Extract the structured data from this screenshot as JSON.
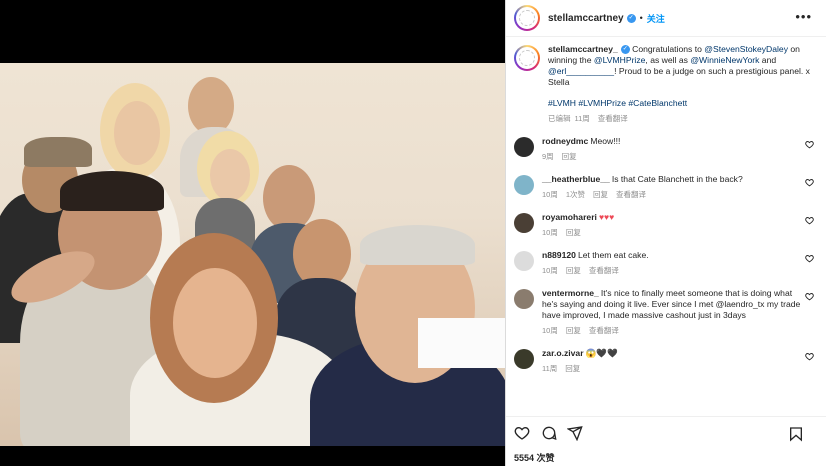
{
  "post": {
    "username": "stellamccartney",
    "follow_label": "关注",
    "separator": "•",
    "more_label": "•••",
    "caption": {
      "username": "stellamccartney_",
      "parts": [
        {
          "text": " Congratulations to ",
          "kind": "text"
        },
        {
          "text": "@StevenStokeyDaley",
          "kind": "mention"
        },
        {
          "text": " on winning the ",
          "kind": "text"
        },
        {
          "text": "@LVMHPrize",
          "kind": "mention"
        },
        {
          "text": ", as well as ",
          "kind": "text"
        },
        {
          "text": "@WinnieNewYork",
          "kind": "mention"
        },
        {
          "text": " and ",
          "kind": "text"
        },
        {
          "text": "@erl__________",
          "kind": "mention"
        },
        {
          "text": "! Proud to be a judge on such a prestigious panel. x Stella",
          "kind": "text"
        }
      ],
      "hashtags": "#LVMH #LVMHPrize #CateBlanchett",
      "edited": "已编辑",
      "time": "11周",
      "translate": "查看翻译"
    },
    "likes": "5554 次赞"
  },
  "comments": [
    {
      "user": "rodneydmc",
      "text": "Meow!!!",
      "time": "9周",
      "likes": "",
      "reply": "回复",
      "translate": "",
      "avatar_color": "#2b2b2b"
    },
    {
      "user": "__heatherblue__",
      "text": "Is that Cate Blanchett in the back?",
      "time": "10周",
      "likes": "1次赞",
      "reply": "回复",
      "translate": "查看翻译",
      "avatar_color": "#7fb4c9"
    },
    {
      "user": "royamohareri",
      "text": "♥♥♥",
      "time": "10周",
      "likes": "",
      "reply": "回复",
      "translate": "",
      "avatar_color": "#4a3f35"
    },
    {
      "user": "n889120",
      "text": "Let them eat cake.",
      "time": "10周",
      "likes": "",
      "reply": "回复",
      "translate": "查看翻译",
      "avatar_color": "#dcdcdc"
    },
    {
      "user": "ventermorne_",
      "text": "It's nice to finally meet someone that is doing what he's saying and doing it live. Ever since I met @laendro_tx my trade have improved, I made massive cashout just in 3days",
      "time": "10周",
      "likes": "",
      "reply": "回复",
      "translate": "查看翻译",
      "avatar_color": "#8a7c6e"
    },
    {
      "user": "zar.o.zivar",
      "text": "😱🖤🖤",
      "time": "11周",
      "likes": "",
      "reply": "回复",
      "translate": "",
      "avatar_color": "#3a3a2a"
    }
  ],
  "icons": {
    "heart": "heart-icon",
    "comment": "comment-icon",
    "share": "share-icon",
    "save": "bookmark-icon",
    "verified": "verified-icon",
    "more": "more-icon"
  },
  "colors": {
    "link": "#00376b",
    "follow": "#0095f6",
    "verified": "#3897f0",
    "muted": "#8e8e8e"
  }
}
